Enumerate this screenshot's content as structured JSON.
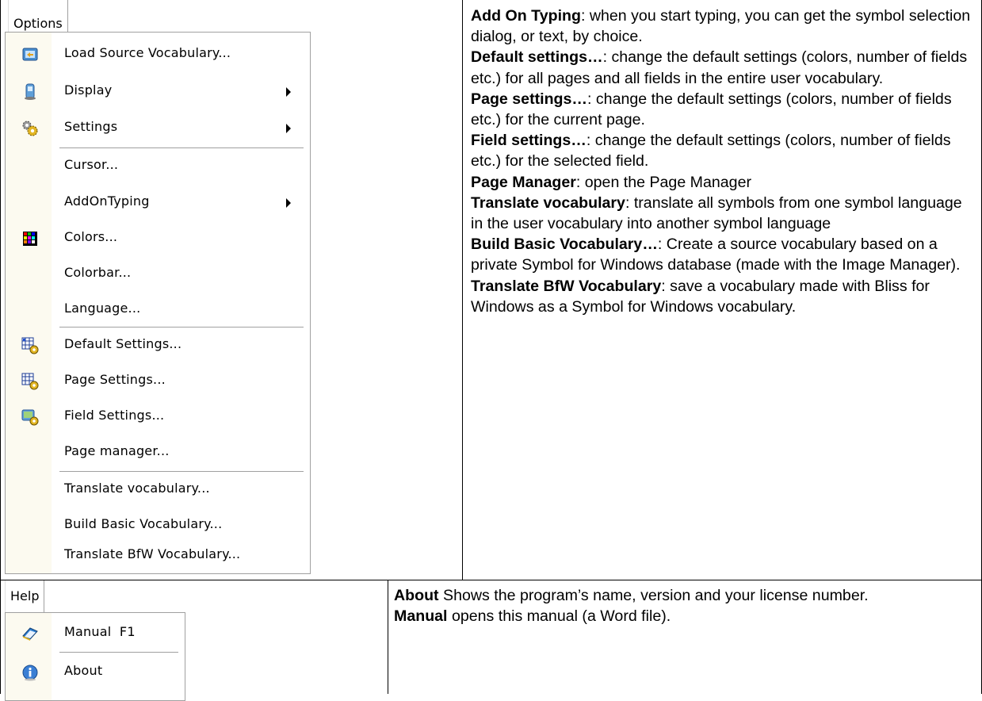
{
  "options_menu": {
    "title": "Options",
    "items": [
      {
        "label": "Load Source Vocabulary...",
        "icon": "load-vocabulary-icon",
        "submenu": false
      },
      {
        "label": "Display",
        "icon": "display-icon",
        "submenu": true
      },
      {
        "label": "Settings",
        "icon": "settings-icon",
        "submenu": true
      },
      {
        "label": "Cursor...",
        "icon": "",
        "submenu": false
      },
      {
        "label": "AddOnTyping",
        "icon": "",
        "submenu": true
      },
      {
        "label": "Colors...",
        "icon": "colors-icon",
        "submenu": false
      },
      {
        "label": "Colorbar...",
        "icon": "",
        "submenu": false
      },
      {
        "label": "Language...",
        "icon": "",
        "submenu": false
      },
      {
        "label": "Default Settings...",
        "icon": "default-settings-icon",
        "submenu": false
      },
      {
        "label": "Page Settings...",
        "icon": "page-settings-icon",
        "submenu": false
      },
      {
        "label": "Field Settings...",
        "icon": "field-settings-icon",
        "submenu": false
      },
      {
        "label": "Page manager...",
        "icon": "",
        "submenu": false
      },
      {
        "label": "Translate vocabulary...",
        "icon": "",
        "submenu": false
      },
      {
        "label": "Build Basic Vocabulary...",
        "icon": "",
        "submenu": false
      },
      {
        "label": "Translate BfW Vocabulary...",
        "icon": "",
        "submenu": false
      }
    ]
  },
  "options_desc": [
    {
      "term": "Add On Typing",
      "text": ": when you start typing, you can get the symbol selection dialog, or text, by choice."
    },
    {
      "term": "Default settings…",
      "text": ": change the default settings (colors, number of fields etc.) for all pages and all fields in the entire user vocabulary."
    },
    {
      "term": "Page settings…",
      "text": ": change the default settings (colors, number of fields etc.) for the current page."
    },
    {
      "term": "Field settings…",
      "text": ": change the default settings (colors, number of fields etc.) for the selected field."
    },
    {
      "term": "Page Manager",
      "text": ": open the Page Manager"
    },
    {
      "term": "Translate vocabulary",
      "text": ": translate all symbols from one symbol language in the user vocabulary into another symbol language"
    },
    {
      "term": "Build Basic Vocabulary…",
      "text": ": Create a source vocabulary based on a private Symbol for Windows database (made with the Image Manager)."
    },
    {
      "term": "Translate BfW Vocabulary",
      "text": ": save a vocabulary made with Bliss for Windows as a Symbol for Windows vocabulary."
    }
  ],
  "help_menu": {
    "title": "Help",
    "items": [
      {
        "label": "Manual  F1",
        "icon": "manual-book-icon"
      },
      {
        "label": "About",
        "icon": "about-info-icon"
      }
    ]
  },
  "help_desc": [
    {
      "term": "About",
      "text": " Shows the program’s name, version and your license number."
    },
    {
      "term": "Manual",
      "text": " opens this manual (a Word file)."
    }
  ],
  "colors": {
    "gutter": "#fcfaf0",
    "separator": "#a0a0a0",
    "border": "#000000"
  }
}
